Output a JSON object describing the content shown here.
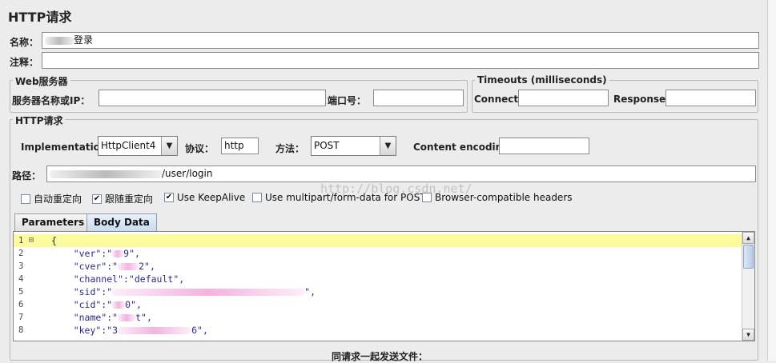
{
  "panel": {
    "title": "HTTP请求"
  },
  "name_row": {
    "label": "名称：",
    "value_suffix": "登录"
  },
  "comment_row": {
    "label": "注释：",
    "value": ""
  },
  "web_server": {
    "legend": "Web服务器",
    "server_label": "服务器名称或IP：",
    "server_value": "",
    "port_label": "端口号：",
    "port_value": ""
  },
  "timeouts": {
    "legend": "Timeouts (milliseconds)",
    "connect_label": "Connect:",
    "connect_value": "",
    "response_label": "Response:",
    "response_value": ""
  },
  "http_request": {
    "legend": "HTTP请求",
    "implementation_label": "Implementation:",
    "implementation_value": "HttpClient4",
    "protocol_label": "协议：",
    "protocol_value": "http",
    "method_label": "方法：",
    "method_value": "POST",
    "encoding_label": "Content encoding:",
    "encoding_value": "",
    "path_label": "路径：",
    "path_suffix": "/user/login",
    "watermark": "http://blog.csdn.net/"
  },
  "options": {
    "auto_redirect": {
      "label": "自动重定向",
      "checked": false
    },
    "follow_redirect": {
      "label": "跟随重定向",
      "checked": true
    },
    "keepalive": {
      "label": "Use KeepAlive",
      "checked": true
    },
    "multipart": {
      "label": "Use multipart/form-data for POST",
      "checked": false
    },
    "browser_headers": {
      "label": "Browser-compatible headers",
      "checked": false
    }
  },
  "tabs": {
    "parameters": "Parameters",
    "body_data": "Body Data",
    "active": "Body Data"
  },
  "body": {
    "lines": [
      {
        "n": "1",
        "pre": "{",
        "post": ""
      },
      {
        "n": "2",
        "pre": "    \"ver\":\"",
        "post": "9\","
      },
      {
        "n": "3",
        "pre": "    \"cver\":\"",
        "post": "2\","
      },
      {
        "n": "4",
        "pre": "    \"channel\":\"default\",",
        "post": ""
      },
      {
        "n": "5",
        "pre": "    \"sid\":\"",
        "post": "\","
      },
      {
        "n": "6",
        "pre": "    \"cid\":\"",
        "post": "0\","
      },
      {
        "n": "7",
        "pre": "    \"name\":\"",
        "post": "t\","
      },
      {
        "n": "8",
        "pre": "    \"key\":\"3",
        "post": "6\","
      }
    ],
    "fold_icon": "⊟"
  },
  "footer": {
    "files_label": "同请求一起发送文件："
  }
}
